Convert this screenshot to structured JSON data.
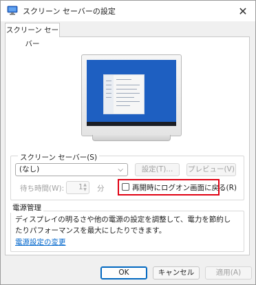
{
  "window": {
    "title": "スクリーン セーバーの設定",
    "close_glyph": "✕"
  },
  "tabs": [
    {
      "label": "スクリーン セーバー"
    }
  ],
  "screensaver_group": {
    "label": "スクリーン セーバー(S)",
    "selected_option": "(なし)",
    "settings_button": "設定(T)...",
    "preview_button": "プレビュー(V)",
    "wait_label": "待ち時間(W):",
    "wait_value": "1",
    "wait_unit": "分",
    "resume_logon_label": "再開時にログオン画面に戻る(R)",
    "resume_logon_checked": false
  },
  "power_group": {
    "label": "電源管理",
    "description": "ディスプレイの明るさや他の電源の設定を調整して、電力を節約したりパフォーマンスを最大にしたりできます。",
    "link_text": "電源設定の変更"
  },
  "buttons": {
    "ok": "OK",
    "cancel": "キャンセル",
    "apply": "適用(A)"
  },
  "colors": {
    "accent": "#0067c0",
    "highlight_box": "#e00012",
    "screen_background": "#1e5fc1",
    "link": "#0066cc"
  },
  "icons": {
    "app": "display-settings-icon",
    "close": "close-icon",
    "dropdown": "chevron-down-icon",
    "spin": "spinner-arrows-icon"
  }
}
